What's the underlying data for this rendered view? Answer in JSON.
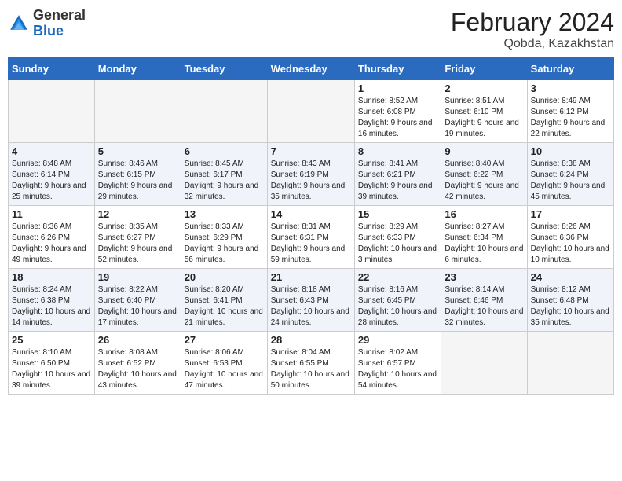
{
  "header": {
    "logo_general": "General",
    "logo_blue": "Blue",
    "month": "February 2024",
    "location": "Qobda, Kazakhstan"
  },
  "days_of_week": [
    "Sunday",
    "Monday",
    "Tuesday",
    "Wednesday",
    "Thursday",
    "Friday",
    "Saturday"
  ],
  "weeks": [
    [
      {
        "day": "",
        "info": ""
      },
      {
        "day": "",
        "info": ""
      },
      {
        "day": "",
        "info": ""
      },
      {
        "day": "",
        "info": ""
      },
      {
        "day": "1",
        "info": "Sunrise: 8:52 AM\nSunset: 6:08 PM\nDaylight: 9 hours\nand 16 minutes."
      },
      {
        "day": "2",
        "info": "Sunrise: 8:51 AM\nSunset: 6:10 PM\nDaylight: 9 hours\nand 19 minutes."
      },
      {
        "day": "3",
        "info": "Sunrise: 8:49 AM\nSunset: 6:12 PM\nDaylight: 9 hours\nand 22 minutes."
      }
    ],
    [
      {
        "day": "4",
        "info": "Sunrise: 8:48 AM\nSunset: 6:14 PM\nDaylight: 9 hours\nand 25 minutes."
      },
      {
        "day": "5",
        "info": "Sunrise: 8:46 AM\nSunset: 6:15 PM\nDaylight: 9 hours\nand 29 minutes."
      },
      {
        "day": "6",
        "info": "Sunrise: 8:45 AM\nSunset: 6:17 PM\nDaylight: 9 hours\nand 32 minutes."
      },
      {
        "day": "7",
        "info": "Sunrise: 8:43 AM\nSunset: 6:19 PM\nDaylight: 9 hours\nand 35 minutes."
      },
      {
        "day": "8",
        "info": "Sunrise: 8:41 AM\nSunset: 6:21 PM\nDaylight: 9 hours\nand 39 minutes."
      },
      {
        "day": "9",
        "info": "Sunrise: 8:40 AM\nSunset: 6:22 PM\nDaylight: 9 hours\nand 42 minutes."
      },
      {
        "day": "10",
        "info": "Sunrise: 8:38 AM\nSunset: 6:24 PM\nDaylight: 9 hours\nand 45 minutes."
      }
    ],
    [
      {
        "day": "11",
        "info": "Sunrise: 8:36 AM\nSunset: 6:26 PM\nDaylight: 9 hours\nand 49 minutes."
      },
      {
        "day": "12",
        "info": "Sunrise: 8:35 AM\nSunset: 6:27 PM\nDaylight: 9 hours\nand 52 minutes."
      },
      {
        "day": "13",
        "info": "Sunrise: 8:33 AM\nSunset: 6:29 PM\nDaylight: 9 hours\nand 56 minutes."
      },
      {
        "day": "14",
        "info": "Sunrise: 8:31 AM\nSunset: 6:31 PM\nDaylight: 9 hours\nand 59 minutes."
      },
      {
        "day": "15",
        "info": "Sunrise: 8:29 AM\nSunset: 6:33 PM\nDaylight: 10 hours\nand 3 minutes."
      },
      {
        "day": "16",
        "info": "Sunrise: 8:27 AM\nSunset: 6:34 PM\nDaylight: 10 hours\nand 6 minutes."
      },
      {
        "day": "17",
        "info": "Sunrise: 8:26 AM\nSunset: 6:36 PM\nDaylight: 10 hours\nand 10 minutes."
      }
    ],
    [
      {
        "day": "18",
        "info": "Sunrise: 8:24 AM\nSunset: 6:38 PM\nDaylight: 10 hours\nand 14 minutes."
      },
      {
        "day": "19",
        "info": "Sunrise: 8:22 AM\nSunset: 6:40 PM\nDaylight: 10 hours\nand 17 minutes."
      },
      {
        "day": "20",
        "info": "Sunrise: 8:20 AM\nSunset: 6:41 PM\nDaylight: 10 hours\nand 21 minutes."
      },
      {
        "day": "21",
        "info": "Sunrise: 8:18 AM\nSunset: 6:43 PM\nDaylight: 10 hours\nand 24 minutes."
      },
      {
        "day": "22",
        "info": "Sunrise: 8:16 AM\nSunset: 6:45 PM\nDaylight: 10 hours\nand 28 minutes."
      },
      {
        "day": "23",
        "info": "Sunrise: 8:14 AM\nSunset: 6:46 PM\nDaylight: 10 hours\nand 32 minutes."
      },
      {
        "day": "24",
        "info": "Sunrise: 8:12 AM\nSunset: 6:48 PM\nDaylight: 10 hours\nand 35 minutes."
      }
    ],
    [
      {
        "day": "25",
        "info": "Sunrise: 8:10 AM\nSunset: 6:50 PM\nDaylight: 10 hours\nand 39 minutes."
      },
      {
        "day": "26",
        "info": "Sunrise: 8:08 AM\nSunset: 6:52 PM\nDaylight: 10 hours\nand 43 minutes."
      },
      {
        "day": "27",
        "info": "Sunrise: 8:06 AM\nSunset: 6:53 PM\nDaylight: 10 hours\nand 47 minutes."
      },
      {
        "day": "28",
        "info": "Sunrise: 8:04 AM\nSunset: 6:55 PM\nDaylight: 10 hours\nand 50 minutes."
      },
      {
        "day": "29",
        "info": "Sunrise: 8:02 AM\nSunset: 6:57 PM\nDaylight: 10 hours\nand 54 minutes."
      },
      {
        "day": "",
        "info": ""
      },
      {
        "day": "",
        "info": ""
      }
    ]
  ]
}
